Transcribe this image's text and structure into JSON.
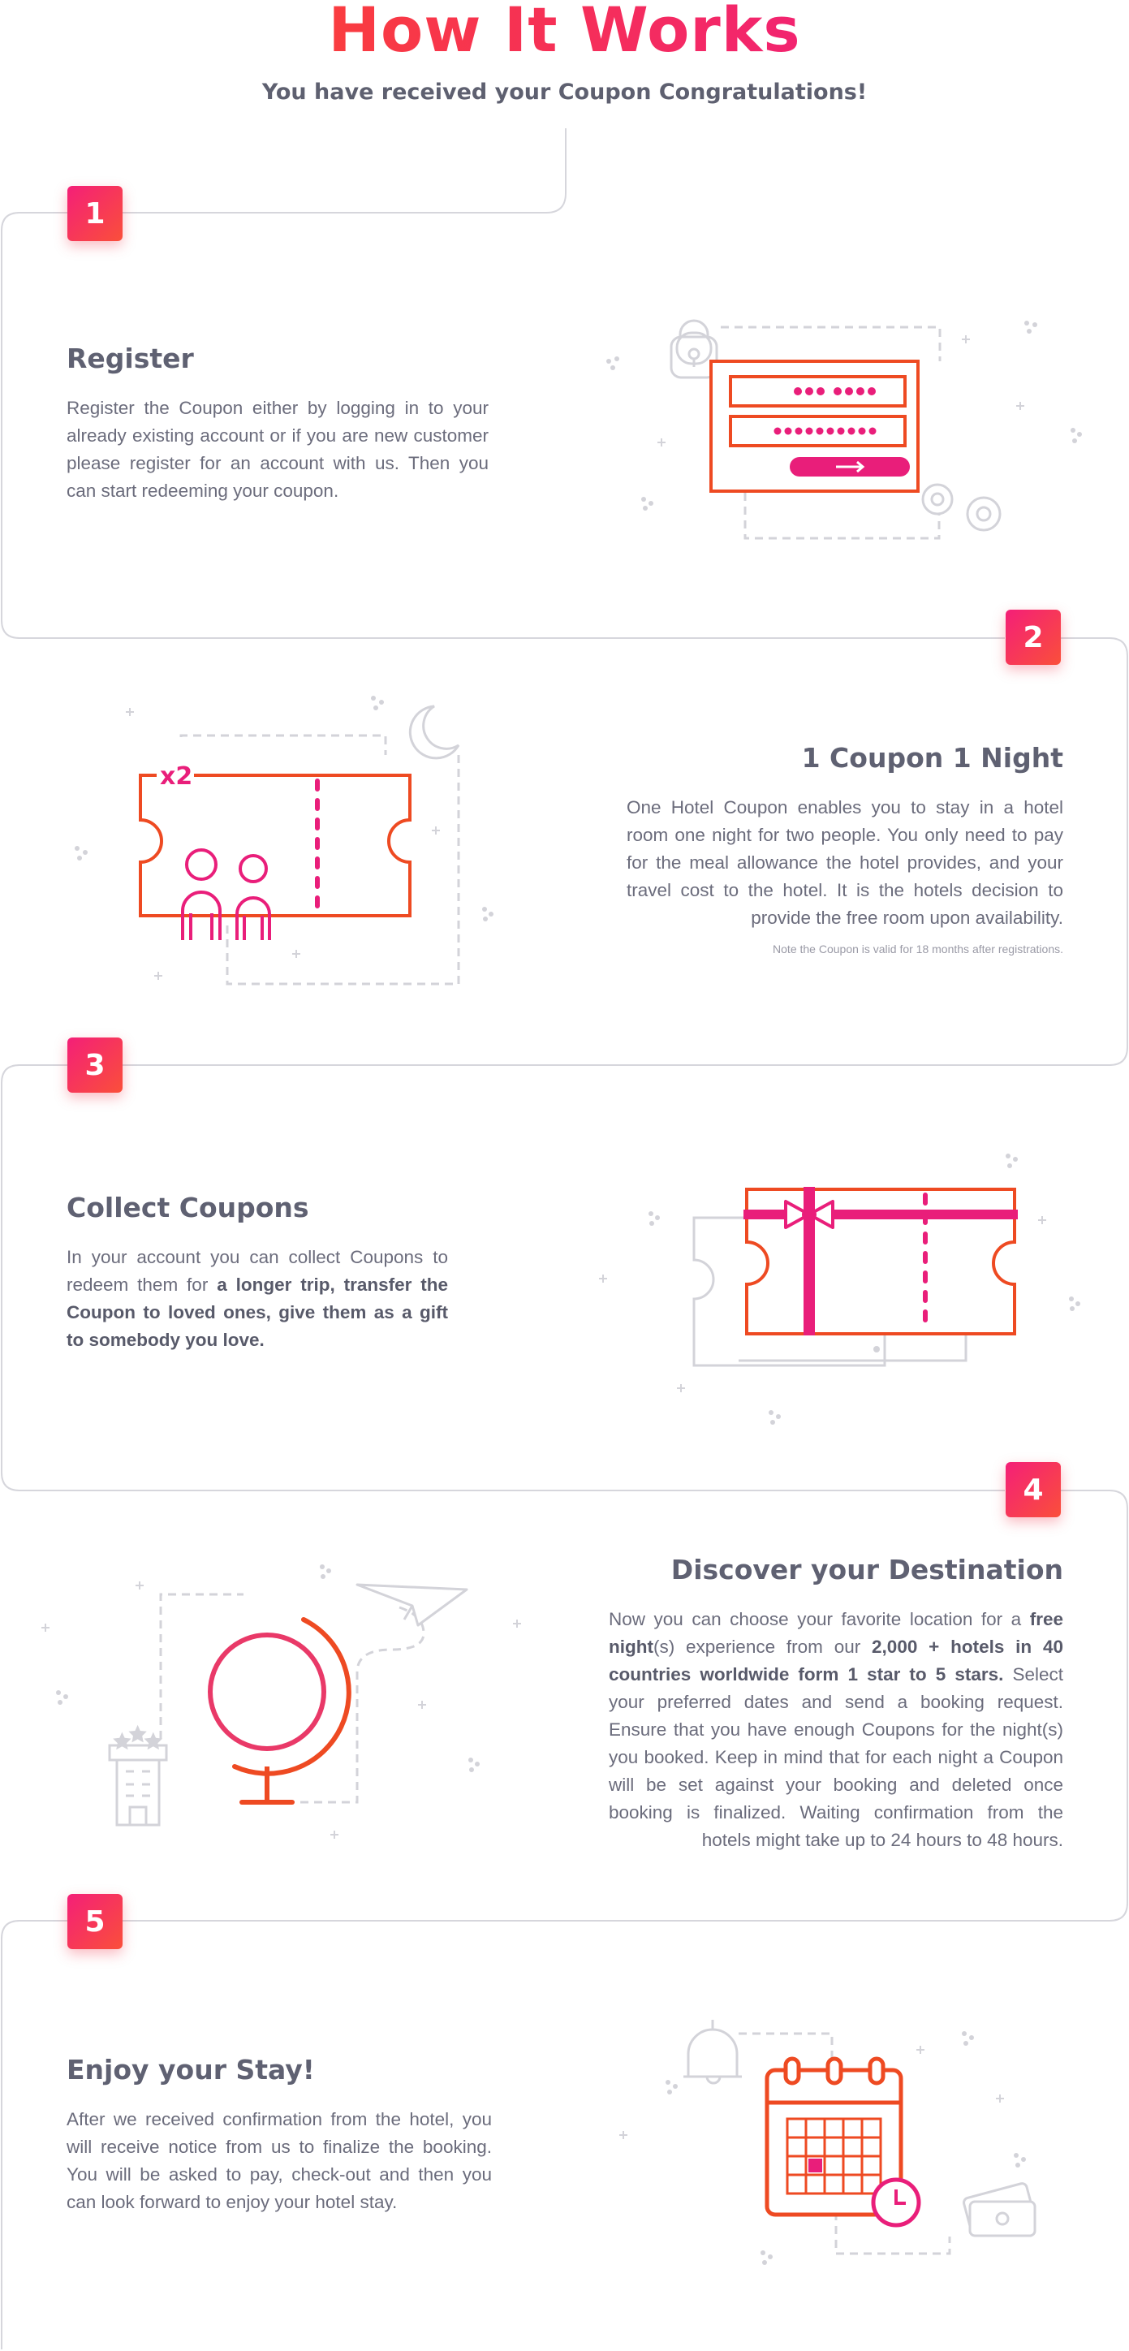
{
  "header": {
    "title": "How It Works",
    "subtitle": "You have received your Coupon Congratulations!"
  },
  "colors": {
    "accent_orange": "#ee4a22",
    "accent_pink": "#e91e7a",
    "line_gray": "#d7d7dd",
    "text": "#6b6c7c"
  },
  "steps": [
    {
      "number": "1",
      "title": "Register",
      "text": "Register the Coupon either by logging in to your already existing account or if you are new customer please register for an account with us. Then you can start redeeming your coupon.",
      "illustration": "login-form-icon"
    },
    {
      "number": "2",
      "title": "1 Coupon 1 Night",
      "text": "One Hotel Coupon enables you to stay in a hotel room one night for two people. You only need to pay for the meal allowance the hotel provides, and your travel cost to the hotel. It is the hotels decision to provide the free room upon availability.",
      "note": "Note the Coupon is valid for 18 months after registrations.",
      "illustration_badge": "x2",
      "illustration": "coupon-two-people-icon"
    },
    {
      "number": "3",
      "title": "Collect Coupons",
      "text_plain": "In your account you can collect Coupons to redeem them for ",
      "text_bold": "a longer trip, transfer the Coupon to loved ones, give them as a gift to somebody you love.",
      "illustration": "gift-coupon-icon"
    },
    {
      "number": "4",
      "title": "Discover your Destination",
      "text_1": "Now you can choose your favorite location for a ",
      "text_bold_1": "free night",
      "text_2": "(s) experience from our ",
      "text_bold_2": "2,000 + hotels in 40 countries worldwide form 1 star to 5 stars.",
      "text_3": " Select your preferred dates and send a booking request. Ensure that you have enough Coupons for the night(s) you booked. Keep in mind that for each night a Coupon will be set against your booking and deleted once booking is finalized. Waiting confirmation from the hotels might take up to 24 hours to 48 hours.",
      "illustration": "globe-hotel-plane-icon"
    },
    {
      "number": "5",
      "title": "Enjoy your Stay!",
      "text": "After we received confirmation from the hotel, you will receive notice from us to finalize the booking. You will be asked to pay, check-out and then you can look forward to enjoy your hotel stay.",
      "illustration": "calendar-booking-icon"
    }
  ]
}
